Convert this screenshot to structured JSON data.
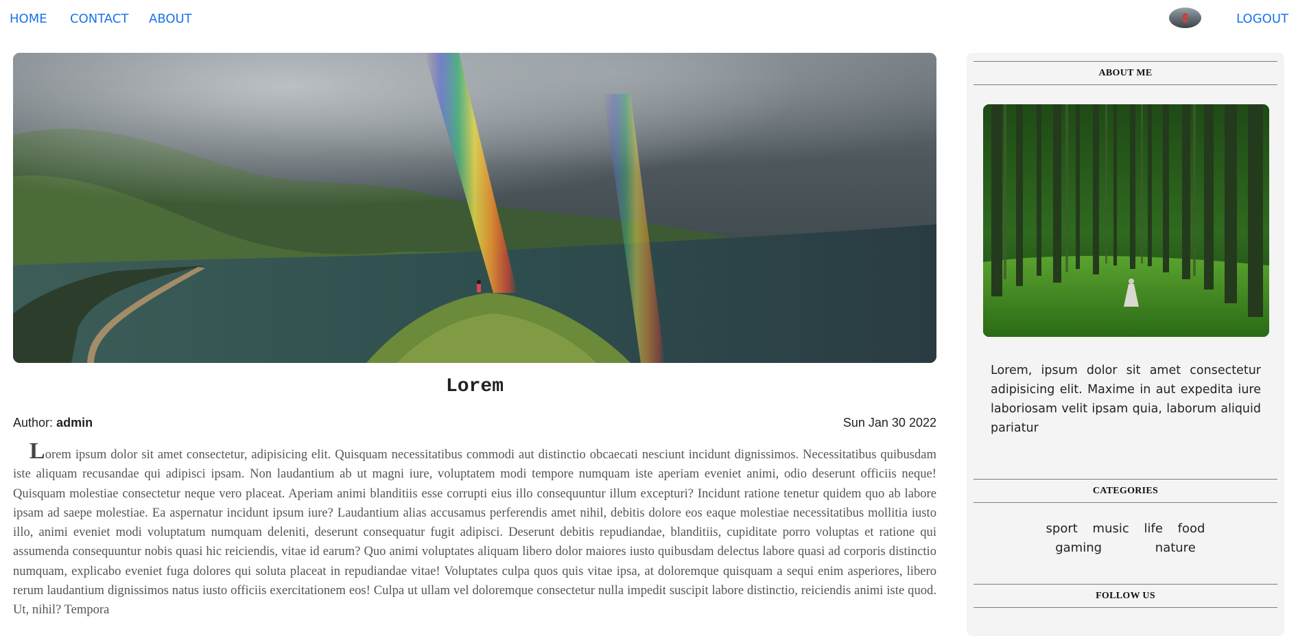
{
  "nav": {
    "home": "HOME",
    "contact": "CONTACT",
    "about": "ABOUT",
    "logout": "LOGOUT"
  },
  "post": {
    "title": "Lorem",
    "author_label": "Author:",
    "author_name": "admin",
    "date": "Sun Jan 30 2022",
    "dropcap": "L",
    "body": "orem ipsum dolor sit amet consectetur, adipisicing elit. Quisquam necessitatibus commodi aut distinctio obcaecati nesciunt incidunt dignissimos. Necessitatibus quibusdam iste aliquam recusandae qui adipisci ipsam. Non laudantium ab ut magni iure, voluptatem modi tempore numquam iste aperiam eveniet animi, odio deserunt officiis neque! Quisquam molestiae consectetur neque vero placeat. Aperiam animi blanditiis esse corrupti eius illo consequuntur illum excepturi? Incidunt ratione tenetur quidem quo ab labore ipsam ad saepe molestiae. Ea aspernatur incidunt ipsum iure? Laudantium alias accusamus perferendis amet nihil, debitis dolore eos eaque molestiae necessitatibus mollitia iusto illo, animi eveniet modi voluptatum numquam deleniti, deserunt consequatur fugit adipisci. Deserunt debitis repudiandae, blanditiis, cupiditate porro voluptas et ratione qui assumenda consequuntur nobis quasi hic reiciendis, vitae id earum? Quo animi voluptates aliquam libero dolor maiores iusto quibusdam delectus labore quasi ad corporis distinctio numquam, explicabo eveniet fuga dolores qui soluta placeat in repudiandae vitae! Voluptates culpa quos quis vitae ipsa, at doloremque quisquam a sequi enim asperiores, libero rerum laudantium dignissimos natus iusto officiis exercitationem eos! Culpa ut ullam vel doloremque consectetur nulla impedit suscipit labore distinctio, reiciendis animi iste quod. Ut, nihil? Tempora"
  },
  "sidebar": {
    "about_heading": "ABOUT ME",
    "about_text": "Lorem, ipsum dolor sit amet consectetur adipisicing elit. Maxime in aut expedita iure laboriosam velit ipsam quia, laborum aliquid pariatur",
    "categories_heading": "CATEGORIES",
    "categories": [
      "sport",
      "music",
      "life",
      "food",
      "gaming",
      "nature"
    ],
    "follow_heading": "FOLLOW US"
  }
}
